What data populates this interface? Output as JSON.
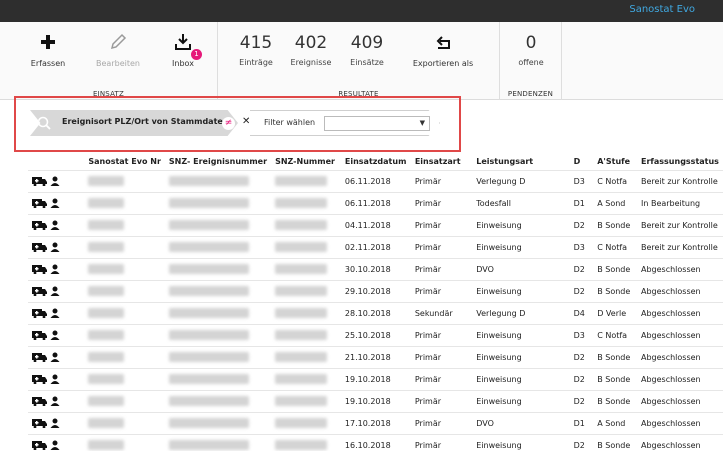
{
  "app": {
    "title": "Sanostat Evo"
  },
  "ribbon": {
    "einsatz": {
      "label": "EINSATZ",
      "erfassen": "Erfassen",
      "bearbeiten": "Bearbeiten",
      "inbox": "Inbox",
      "inbox_badge": "1"
    },
    "resultate": {
      "label": "RESULTATE",
      "eintraege_num": "415",
      "eintraege_label": "Einträge",
      "ereignisse_num": "402",
      "ereignisse_label": "Ereignisse",
      "einsaetze_num": "409",
      "einsaetze_label": "Einsätze",
      "exportieren": "Exportieren als"
    },
    "pendenzen": {
      "label": "PENDENZEN",
      "offene_num": "0",
      "offene_label": "offene"
    }
  },
  "filter": {
    "active_label": "Ereignisort PLZ/Ort von Stammdaten",
    "operator": "≠",
    "remove": "✕",
    "choose_label": "Filter wählen",
    "select_value": ""
  },
  "table": {
    "columns": [
      "",
      "Sanostat Evo Nr",
      "SNZ- Ereignisnummer",
      "SNZ-Nummer",
      "Einsatzdatum",
      "Einsatzart",
      "Leistungsart",
      "D",
      "A'Stufe",
      "Erfassungsstatus"
    ],
    "rows": [
      [
        "06.11.2018",
        "Primär",
        "Verlegung D",
        "D3",
        "C Notfa",
        "Bereit zur Kontrolle"
      ],
      [
        "06.11.2018",
        "Primär",
        "Todesfall",
        "D1",
        "A Sond",
        "In Bearbeitung"
      ],
      [
        "04.11.2018",
        "Primär",
        "Einweisung",
        "D2",
        "B Sonde",
        "Bereit zur Kontrolle"
      ],
      [
        "02.11.2018",
        "Primär",
        "Einweisung",
        "D3",
        "C Notfa",
        "Bereit zur Kontrolle"
      ],
      [
        "30.10.2018",
        "Primär",
        "DVO",
        "D2",
        "B Sonde",
        "Abgeschlossen"
      ],
      [
        "29.10.2018",
        "Primär",
        "Einweisung",
        "D2",
        "B Sonde",
        "Abgeschlossen"
      ],
      [
        "28.10.2018",
        "Sekundär",
        "Verlegung D",
        "D4",
        "D Verle",
        "Abgeschlossen"
      ],
      [
        "25.10.2018",
        "Primär",
        "Einweisung",
        "D3",
        "C Notfa",
        "Abgeschlossen"
      ],
      [
        "21.10.2018",
        "Primär",
        "Einweisung",
        "D2",
        "B Sonde",
        "Abgeschlossen"
      ],
      [
        "19.10.2018",
        "Primär",
        "Einweisung",
        "D2",
        "B Sonde",
        "Abgeschlossen"
      ],
      [
        "19.10.2018",
        "Primär",
        "Einweisung",
        "D2",
        "B Sonde",
        "Abgeschlossen"
      ],
      [
        "17.10.2018",
        "Primär",
        "DVO",
        "D1",
        "A Sond",
        "Abgeschlossen"
      ],
      [
        "16.10.2018",
        "Primär",
        "Einweisung",
        "D2",
        "B Sonde",
        "Abgeschlossen"
      ]
    ]
  },
  "colors": {
    "accent": "#40a8e0",
    "badge": "#e6197a",
    "highlight_border": "#e04848"
  }
}
